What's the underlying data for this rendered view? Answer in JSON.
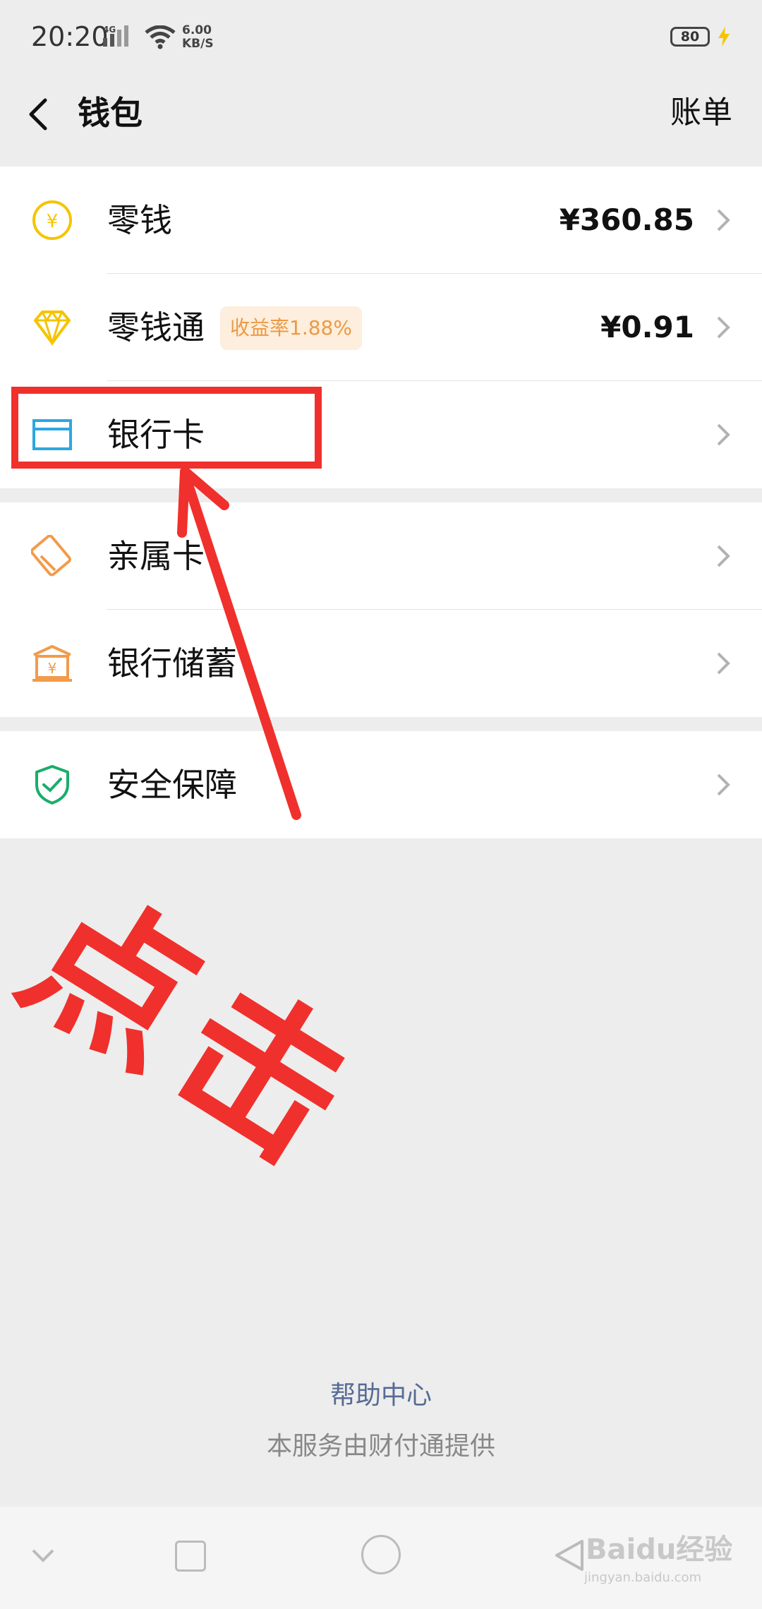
{
  "status_bar": {
    "time": "20:20",
    "network_type": "4G",
    "net_speed_value": "6.00",
    "net_speed_unit": "KB/S",
    "battery": "80"
  },
  "header": {
    "back_icon": "chevron-left-icon",
    "title": "钱包",
    "bill_label": "账单"
  },
  "groups": [
    {
      "items": [
        {
          "icon": "yuan-coin-icon",
          "label": "零钱",
          "value": "¥360.85"
        },
        {
          "icon": "diamond-icon",
          "label": "零钱通",
          "badge": "收益率1.88%",
          "value": "¥0.91"
        },
        {
          "icon": "bank-card-icon",
          "label": "银行卡",
          "value": ""
        }
      ]
    },
    {
      "items": [
        {
          "icon": "family-card-icon",
          "label": "亲属卡"
        },
        {
          "icon": "bank-savings-icon",
          "label": "银行储蓄"
        }
      ]
    },
    {
      "items": [
        {
          "icon": "shield-check-icon",
          "label": "安全保障"
        }
      ]
    }
  ],
  "footer": {
    "help_center": "帮助中心",
    "provider": "本服务由财付通提供"
  },
  "annotation": {
    "text": "点击"
  },
  "watermark": {
    "brand": "Baidu经验",
    "url": "jingyan.baidu.com"
  },
  "colors": {
    "annotation_red": "#f0302c",
    "coin_yellow": "#f5c400",
    "card_blue": "#2ea7e0",
    "orange": "#f29b4b",
    "shield_green": "#1aad6a",
    "link_blue": "#576b95"
  }
}
